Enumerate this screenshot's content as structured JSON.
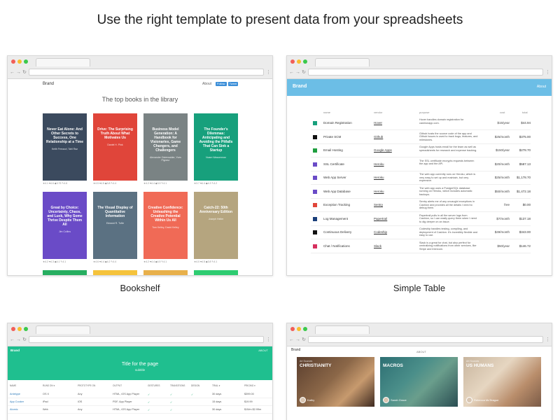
{
  "headline": "Use the right template to present data from your spreadsheets",
  "colors": {
    "accent_table": "#6cbee6",
    "accent_data": "#1fbf8f"
  },
  "captions": {
    "bookshelf": "Bookshelf",
    "simple_table": "Simple Table"
  },
  "bookshelf": {
    "brand": "Brand",
    "about": "About",
    "social": [
      "Follow",
      "Tweet"
    ],
    "title": "The top books in the library",
    "books": [
      {
        "title": "Never Eat Alone: And Other Secrets to Success, One Relationship at a Time",
        "author": "Keith Ferrazzi, Tahl Raz",
        "color": "#3b4a5e",
        "stats": "★4.1 ♥4.6 ◆3.75 ✎4.6"
      },
      {
        "title": "Drive: The Surprising Truth About What Motivates Us",
        "author": "Daniel H. Pink",
        "color": "#e0453a",
        "stats": "★4.5 ♥4.5 ◆3.8 ✎4.4"
      },
      {
        "title": "Business Model Generation: A Handbook for Visionaries, Game Changers, and Challengers",
        "author": "Alexander Osterwalder, Yves Pigneur",
        "color": "#7a8384",
        "stats": "★4.2 ♥4.4 ◆3.9 ✎4.1"
      },
      {
        "title": "The Founder's Dilemmas: Anticipating and Avoiding the Pitfalls That Can Sink a Startup",
        "author": "Noam Wasserman",
        "color": "#17a07c",
        "stats": "★3.7 ♥4.4 ◆4.3 ✎4.2"
      },
      {
        "title": "Great by Choice: Uncertainty, Chaos, and Luck, Why Some Thrive Despite Them All",
        "author": "Jim Collins",
        "color": "#6a4bc7",
        "stats": "★4.2 ♥4.3 ◆4.1 ✎4.1"
      },
      {
        "title": "The Visual Display of Quantitative Information",
        "author": "Edward R. Tufte",
        "color": "#5b7182",
        "stats": "★4.6 ♥4.4 ◆4.2 ✎4.4"
      },
      {
        "title": "Creative Confidence: Unleashing the Creative Potential Within Us All",
        "author": "Tom Kelley, David Kelley",
        "color": "#f06a56",
        "stats": "★4.2 ♥4.4 ◆4.5 ✎4.1"
      },
      {
        "title": "Catch-22: 50th Anniversary Edition",
        "author": "Joseph Heller",
        "color": "#b5a57f",
        "stats": "★4.0 ♥4.5 ◆3.8 ✎4.1"
      }
    ],
    "peek_colors": [
      "#27ae60",
      "#f5c33b",
      "#e8b04b",
      "#2ecc71"
    ]
  },
  "simple_table": {
    "brand": "Brand",
    "about": "About",
    "columns": {
      "name": "name",
      "vendor": "vendor",
      "purpose": "purpose",
      "cost": "cost",
      "total": "total"
    },
    "rows": [
      {
        "swatch": "#17a07c",
        "name": "Domain Registration",
        "vendor": "Hover",
        "purpose": "Hover handles domain registration for cashionapp.com.",
        "cost": "$15/year",
        "total": "$44.94"
      },
      {
        "swatch": "#111111",
        "name": "Private SCM",
        "vendor": "Github",
        "purpose": "Github hosts the source code of the app and Github Issues is used to track bugs, features, and milestones.",
        "cost": "$25/month",
        "total": "$375.00"
      },
      {
        "swatch": "#1e9e3e",
        "name": "Email Hosting",
        "vendor": "Google Apps",
        "purpose": "Google Apps hosts email for the team as well as spreadsheets for research and expense tracking.",
        "cost": "$150/year",
        "total": "$278.70"
      },
      {
        "swatch": "#6a4bc7",
        "name": "SSL Certificate",
        "vendor": "Heroku",
        "purpose": "The SSL certificate encrypts requests between the app and the API.",
        "cost": "$20/month",
        "total": "$587.13"
      },
      {
        "swatch": "#6a4bc7",
        "name": "Web App Server",
        "vendor": "Heroku",
        "purpose": "The web app currently runs on Heroku, which is very easy to set up and maintain, but very expensive.",
        "cost": "$25/month",
        "total": "$1,178.70"
      },
      {
        "swatch": "#6a4bc7",
        "name": "Web App Database",
        "vendor": "Heroku",
        "purpose": "The web app uses a PostgreSQL database running on Heroku, which includes automatic backups.",
        "cost": "$50/month",
        "total": "$1,472.18"
      },
      {
        "swatch": "#e0453a",
        "name": "Exception Tracking",
        "vendor": "Sentry",
        "purpose": "Sentry alerts me of any uncaught exceptions in Cashion and provides all the details I need to debug them.",
        "cost": "free",
        "total": "$0.00"
      },
      {
        "swatch": "#1a3e7a",
        "name": "Log Management",
        "vendor": "Papertrail",
        "purpose": "Papertrail pulls in all the server logs from Cashion, so I can easily query them when I need to dig deeper on an issue.",
        "cost": "$7/month",
        "total": "$137.18"
      },
      {
        "swatch": "#111111",
        "name": "Continuous Delivery",
        "vendor": "Codeship",
        "purpose": "Codeship handles testing, compiling, and deployment of Cashion. It's incredibly flexible and easy to use.",
        "cost": "$49/month",
        "total": "$343.00"
      },
      {
        "swatch": "#d6305e",
        "name": "Chat / Notifications",
        "vendor": "Slack",
        "purpose": "Slack is a great for chat, but also perfect for centralizing notifications from other services, like Stripe and Intercom.",
        "cost": "$50/year",
        "total": "$146.72"
      }
    ]
  },
  "data_table": {
    "brand": "Brand",
    "about": "ABOUT",
    "title": "Title for the page",
    "subtitle": "subtitle",
    "columns": [
      "NAME",
      "RUNS ON ▾",
      "PROTOTYPE ON",
      "OUTPUT",
      "GESTURES",
      "TRANSITIONS",
      "DESIGN",
      "TRIAL ▾",
      "PRICING ▾"
    ],
    "rows": [
      {
        "name": "Antetype",
        "runs_on": "OS X",
        "proto": "Any",
        "output": "HTML, iOS App Player",
        "gestures": "✓",
        "transitions": "✓",
        "design": "✓",
        "trial": "30 days",
        "pricing": "$399.00"
      },
      {
        "name": "App Cooker",
        "runs_on": "iPad",
        "proto": "iOS",
        "output": "PDF, App Player",
        "gestures": "✓",
        "transitions": "✓",
        "design": "",
        "trial": "15 days",
        "pricing": "$19.99"
      },
      {
        "name": "Atomic",
        "runs_on": "Web",
        "proto": "Any",
        "output": "HTML, iOS App Player",
        "gestures": "✓",
        "transitions": "✓",
        "design": "",
        "trial": "30 days",
        "pricing": "$15/m $2.99m"
      }
    ]
  },
  "image_gallery": {
    "brand": "Brand",
    "about": "ABOUT",
    "tiles": [
      {
        "small": "Art Sources",
        "label": "CHRISTIANITY",
        "author": "Kathy",
        "bg": "linear-gradient(135deg,#5a3e2e 0%,#8b6748 45%,#c79a6e 70%,#3e2a20 100%)"
      },
      {
        "small": "",
        "label": "MACROS",
        "author": "Sarah Grace",
        "bg": "linear-gradient(135deg,#2d6f73 0%,#4b8f8a 40%,#6a9e8c 60%,#2a4d52 100%)"
      },
      {
        "small": "Art Sources",
        "label": "US HUMANS",
        "author": "Rebecca McTeague",
        "bg": "linear-gradient(135deg,#c8b59e 0%,#e6d6c1 40%,#b98d6b 70%,#7a5a46 100%)"
      }
    ]
  }
}
